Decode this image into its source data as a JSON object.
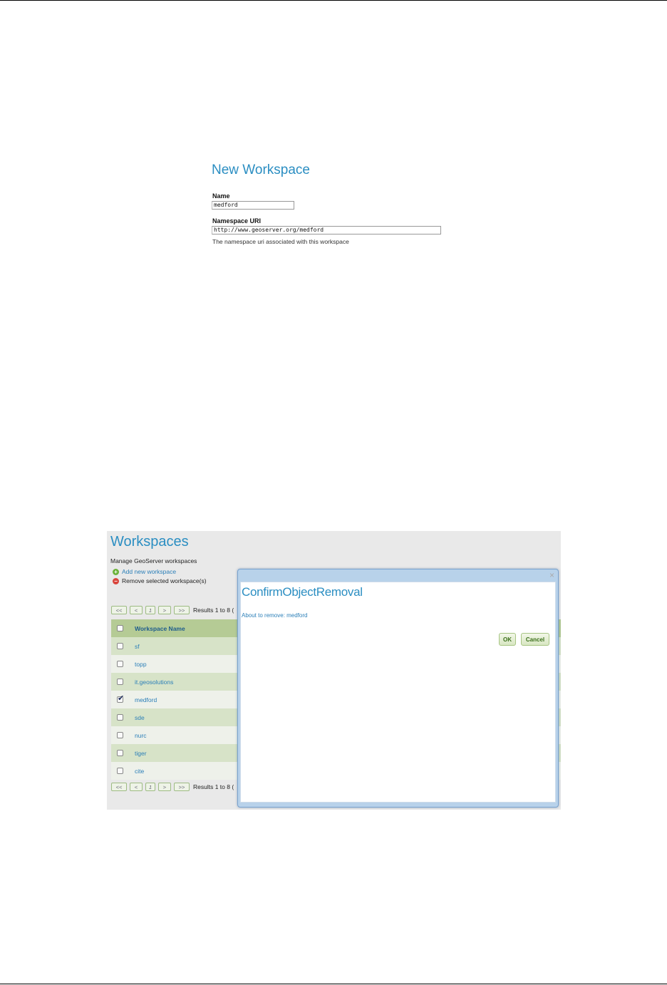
{
  "new_workspace": {
    "title": "New Workspace",
    "name_label": "Name",
    "name_value": "medford",
    "uri_label": "Namespace URI",
    "uri_value": "http://www.geoserver.org/medford",
    "uri_hint": "The namespace uri associated with this workspace"
  },
  "workspaces": {
    "title": "Workspaces",
    "subtitle": "Manage GeoServer workspaces",
    "add_label": "Add new workspace",
    "remove_label": "Remove selected workspace(s)",
    "pager": {
      "first": "<<",
      "prev": "<",
      "current": "1",
      "next": ">",
      "last": ">>",
      "results": "Results 1 to 8 ("
    },
    "column_header": "Workspace Name",
    "rows": [
      {
        "name": "sf",
        "checked": false
      },
      {
        "name": "topp",
        "checked": false
      },
      {
        "name": "it.geosolutions",
        "checked": false
      },
      {
        "name": "medford",
        "checked": true
      },
      {
        "name": "sde",
        "checked": false
      },
      {
        "name": "nurc",
        "checked": false
      },
      {
        "name": "tiger",
        "checked": false
      },
      {
        "name": "cite",
        "checked": false
      }
    ]
  },
  "dialog": {
    "title": "ConfirmObjectRemoval",
    "message": "About to remove: medford",
    "ok_label": "OK",
    "cancel_label": "Cancel",
    "close_icon": "×"
  },
  "colors": {
    "accent": "#2b8ec2",
    "table_header": "#b5cb95",
    "row_odd": "#d7e3c8",
    "dialog_frame": "#b8d2ea"
  }
}
